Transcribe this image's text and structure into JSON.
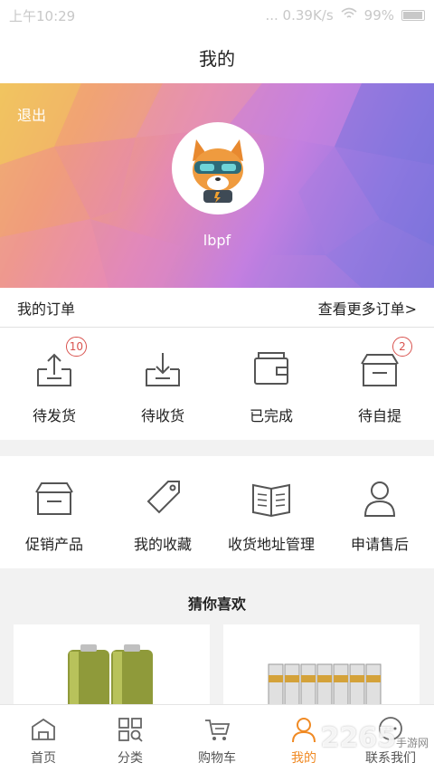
{
  "statusbar": {
    "time": "上午10:29",
    "info": "... 0.39K/s",
    "battery": "99%"
  },
  "header": {
    "title": "我的"
  },
  "profile": {
    "logout_label": "退出",
    "username": "lbpf"
  },
  "orders": {
    "title": "我的订单",
    "more_label": "查看更多订单>",
    "items": [
      {
        "label": "待发货",
        "badge": "10",
        "icon": "outbox-icon"
      },
      {
        "label": "待收货",
        "badge": "",
        "icon": "inbox-icon"
      },
      {
        "label": "已完成",
        "badge": "",
        "icon": "wallet-icon"
      },
      {
        "label": "待自提",
        "badge": "2",
        "icon": "box-icon"
      }
    ]
  },
  "services": {
    "items": [
      {
        "label": "促销产品",
        "icon": "box-icon"
      },
      {
        "label": "我的收藏",
        "icon": "tag-icon"
      },
      {
        "label": "收货地址管理",
        "icon": "book-icon"
      },
      {
        "label": "申请售后",
        "icon": "person-icon"
      }
    ]
  },
  "recommend": {
    "title": "猜你喜欢"
  },
  "tabbar": {
    "items": [
      {
        "label": "首页",
        "icon": "home-icon",
        "active": false
      },
      {
        "label": "分类",
        "icon": "grid-search-icon",
        "active": false
      },
      {
        "label": "购物车",
        "icon": "cart-icon",
        "active": false
      },
      {
        "label": "我的",
        "icon": "user-icon",
        "active": true
      },
      {
        "label": "联系我们",
        "icon": "chat-icon",
        "active": false
      }
    ]
  },
  "watermark": {
    "text": "2265",
    "sub": "手游网"
  },
  "colors": {
    "accent": "#f08a24",
    "badge": "#d9534f"
  }
}
